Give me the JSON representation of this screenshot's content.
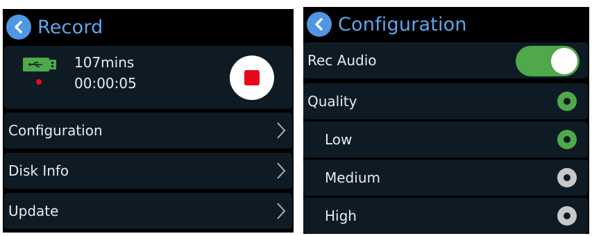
{
  "record_screen": {
    "title": "Record",
    "status": {
      "remaining": "107mins",
      "elapsed": "00:00:05"
    },
    "menu": [
      {
        "label": "Configuration"
      },
      {
        "label": "Disk Info"
      },
      {
        "label": "Update"
      }
    ]
  },
  "config_screen": {
    "title": "Configuration",
    "rec_audio": {
      "label": "Rec Audio",
      "enabled": true
    },
    "quality": {
      "label": "Quality"
    },
    "options": [
      {
        "label": "Low",
        "selected": true
      },
      {
        "label": "Medium",
        "selected": false
      },
      {
        "label": "High",
        "selected": false
      }
    ]
  },
  "colors": {
    "accent_blue": "#5ea6ee",
    "toggle_on": "#4fa84a",
    "radio_selected": "#4fa84a",
    "radio_unselected": "#c8c8c8",
    "record_red": "#e8081c",
    "usb_green": "#4fa84a"
  },
  "icons": [
    "back-arrow-icon",
    "usb-drive-icon",
    "recording-dot-icon",
    "stop-icon",
    "chevron-right-icon",
    "radio-icon",
    "toggle-switch"
  ]
}
